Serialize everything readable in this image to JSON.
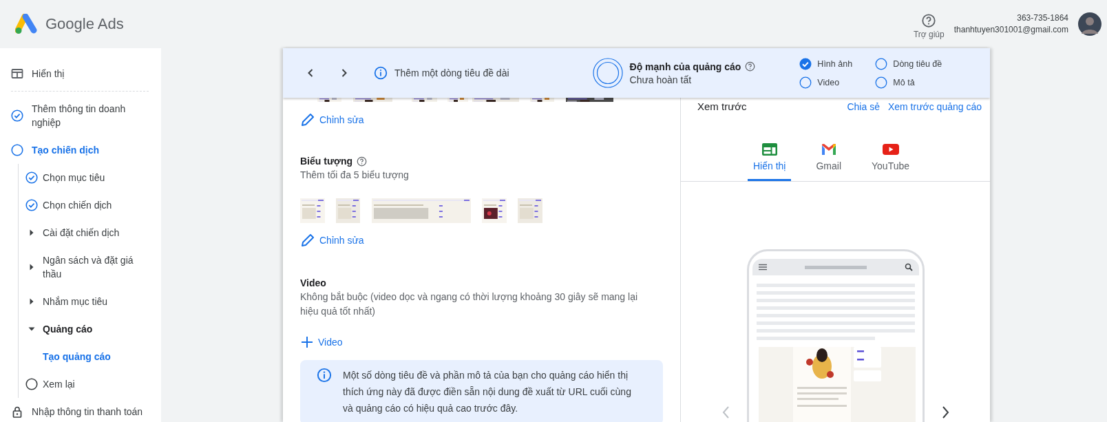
{
  "header": {
    "logo_text": "Google Ads",
    "help_label": "Trợ giúp",
    "account_id": "363-735-1864",
    "email": "thanhtuyen301001@gmail.com"
  },
  "sidebar": {
    "items": [
      {
        "label": "Hiển thị",
        "kind": "display",
        "selected": false
      },
      {
        "label": "Thêm thông tin doanh nghiệp",
        "kind": "done",
        "selected": false
      },
      {
        "label": "Tạo chiến dịch",
        "kind": "todo",
        "selected": true,
        "children": [
          {
            "label": "Chọn mục tiêu",
            "kind": "done",
            "selected": false
          },
          {
            "label": "Chọn chiến dịch",
            "kind": "done",
            "selected": false
          },
          {
            "label": "Cài đặt chiến dịch",
            "kind": "group",
            "expanded": false,
            "selected": false
          },
          {
            "label": "Ngân sách và đặt giá thầu",
            "kind": "group",
            "expanded": false,
            "selected": false
          },
          {
            "label": "Nhắm mục tiêu",
            "kind": "group",
            "expanded": false,
            "selected": false
          },
          {
            "label": "Quảng cáo",
            "kind": "group",
            "expanded": true,
            "selected": false,
            "children": [
              {
                "label": "Tạo quảng cáo",
                "selected": true
              }
            ]
          },
          {
            "label": "Xem lại",
            "kind": "todo",
            "selected": false
          }
        ]
      },
      {
        "label": "Nhập thông tin thanh toán",
        "kind": "locked",
        "selected": false
      }
    ]
  },
  "topbar": {
    "tip": "Thêm một dòng tiêu đề dài",
    "strength_title": "Độ mạnh của quảng cáo",
    "strength_status": "Chưa hoàn tất",
    "checklist": [
      {
        "label": "Hình ảnh",
        "checked": true
      },
      {
        "label": "Dòng tiêu đề",
        "checked": false
      },
      {
        "label": "Video",
        "checked": false
      },
      {
        "label": "Mô tả",
        "checked": false
      }
    ]
  },
  "editor": {
    "images_edit": "Chỉnh sửa",
    "logos": {
      "title": "Biểu tượng",
      "subtitle": "Thêm tối đa 5 biểu tượng",
      "edit": "Chỉnh sửa"
    },
    "video": {
      "title": "Video",
      "subtitle": "Không bắt buộc (video dọc và ngang có thời lượng khoảng 30 giây sẽ mang lại hiệu quả tốt nhất)",
      "add": "Video"
    },
    "notice": "Một số dòng tiêu đề và phần mô tả của bạn cho quảng cáo hiển thị thích ứng này đã được điền sẵn nội dung đề xuất từ URL cuối cùng và quảng cáo có hiệu quả cao trước đây."
  },
  "preview": {
    "title": "Xem trước",
    "links": [
      "Chia sẻ",
      "Xem trước quảng cáo"
    ],
    "tabs": [
      {
        "label": "Hiển thị",
        "kind": "display",
        "selected": true
      },
      {
        "label": "Gmail",
        "kind": "gmail",
        "selected": false
      },
      {
        "label": "YouTube",
        "kind": "youtube",
        "selected": false
      }
    ]
  }
}
